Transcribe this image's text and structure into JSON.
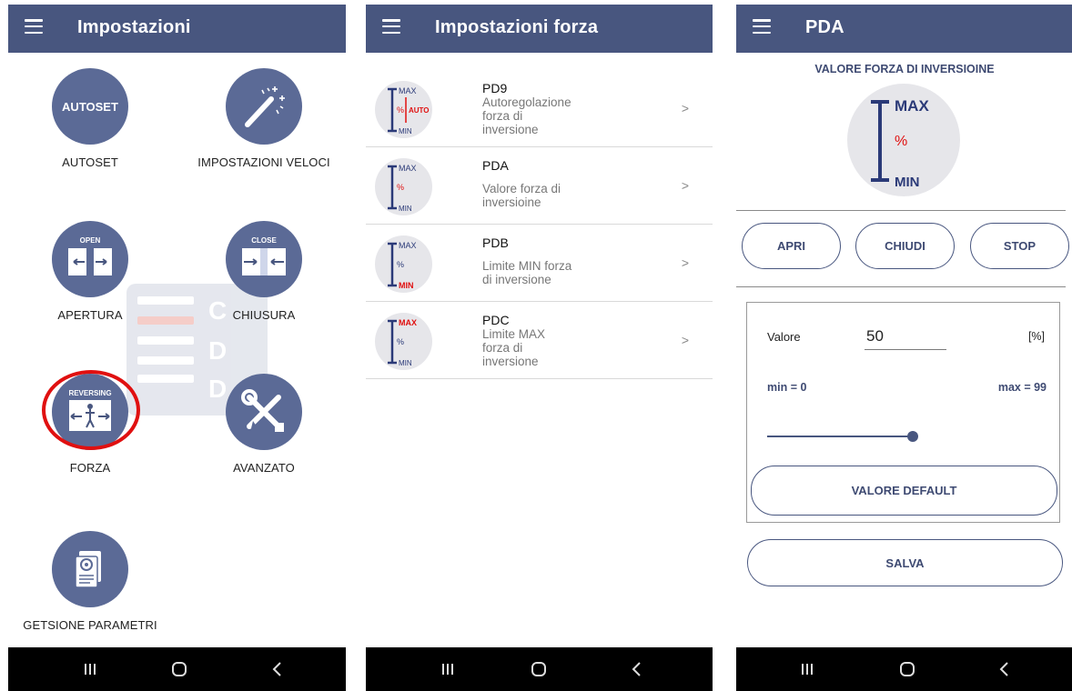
{
  "screen1": {
    "title": "Impostazioni",
    "tiles": [
      {
        "label": "AUTOSET",
        "icon_text": "AUTOSET",
        "icon": "autoset-icon"
      },
      {
        "label": "IMPOSTAZIONI VELOCI",
        "icon": "magic-wand-icon"
      },
      {
        "label": "APERTURA",
        "icon_text": "OPEN",
        "icon": "open-gate-icon"
      },
      {
        "label": "CHIUSURA",
        "icon_text": "CLOSE",
        "icon": "close-gate-icon"
      },
      {
        "label": "FORZA",
        "icon_text": "REVERSING",
        "icon": "reversing-icon"
      },
      {
        "label": "AVANZATO",
        "icon": "wrench-screwdriver-icon"
      },
      {
        "label": "GETSIONE PARAMETRI",
        "icon": "document-gear-icon"
      }
    ],
    "watermark_letters": [
      "C",
      "D",
      "D"
    ]
  },
  "screen2": {
    "title": "Impostazioni forza",
    "items": [
      {
        "code": "PD9",
        "description": "Autoregolazione\nforza di\ninversione",
        "arrow": ">",
        "icon_max": "MAX",
        "icon_mid": "%",
        "icon_auto": "AUTO",
        "icon_min": "MIN"
      },
      {
        "code": "PDA",
        "description": "Valore forza di\ninversioine",
        "arrow": ">",
        "icon_max": "MAX",
        "icon_mid": "%",
        "icon_min": "MIN"
      },
      {
        "code": "PDB",
        "description": "Limite MIN forza\ndi inversione",
        "arrow": ">",
        "icon_max": "MAX",
        "icon_mid": "%",
        "icon_min": "MIN"
      },
      {
        "code": "PDC",
        "description": "Limite MAX\nforza di\ninversione",
        "arrow": ">",
        "icon_max": "MAX",
        "icon_mid": "%",
        "icon_min": "MIN"
      }
    ]
  },
  "screen3": {
    "title": "PDA",
    "header": "VALORE FORZA DI INVERSIOINE",
    "gauge": {
      "max": "MAX",
      "mid": "%",
      "min": "MIN"
    },
    "buttons": {
      "open": "APRI",
      "close": "CHIUDI",
      "stop": "STOP"
    },
    "value_label": "Valore",
    "value": "50",
    "unit": "[%]",
    "min_text": "min = 0",
    "max_text": "max = 99",
    "slider": {
      "min": 0,
      "max": 99,
      "value": 99
    },
    "default_button": "VALORE DEFAULT",
    "save_button": "SALVA"
  },
  "colors": {
    "primary": "#48567f",
    "icon_bg": "#5b6a96",
    "accent_red": "#e01010"
  }
}
